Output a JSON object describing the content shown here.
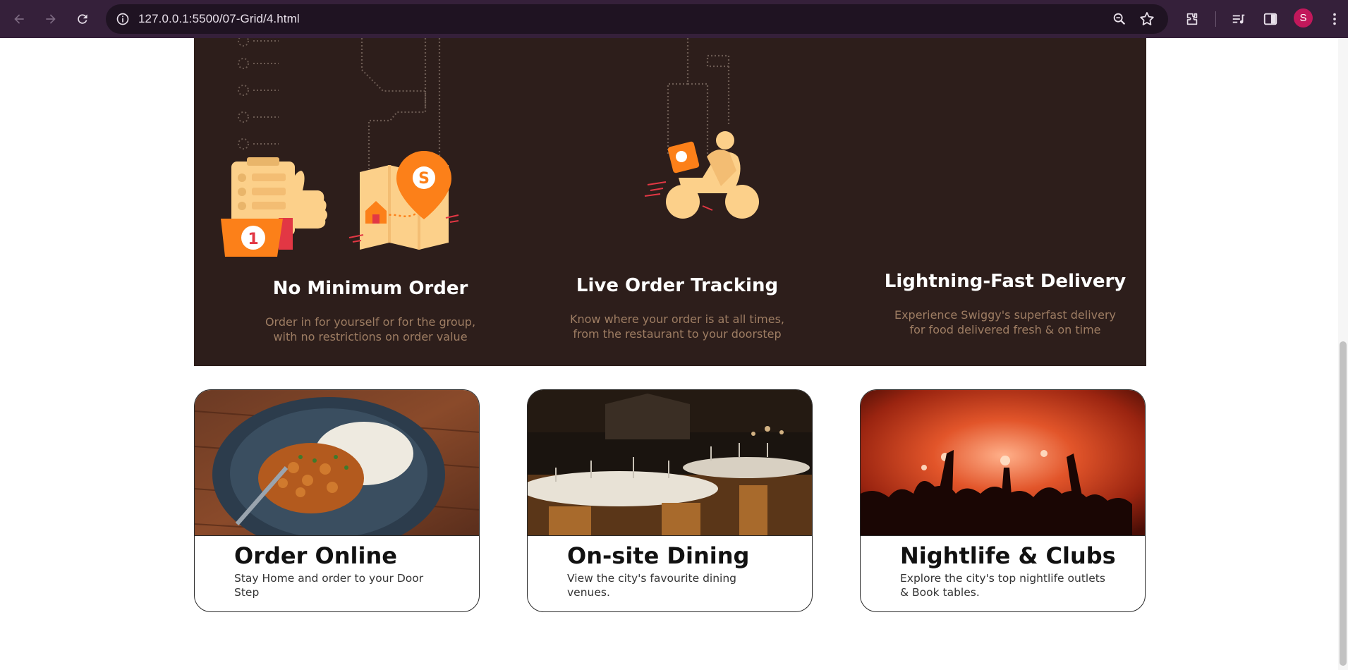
{
  "browser": {
    "url": "127.0.0.1:5500/07-Grid/4.html",
    "profile_initial": "S",
    "icons": [
      "back-icon",
      "forward-icon",
      "reload-icon",
      "site-info-icon",
      "zoom-icon",
      "bookmark-star-icon",
      "extensions-icon",
      "media-icon",
      "side-panel-icon",
      "menu-icon"
    ]
  },
  "features": [
    {
      "title": "No Minimum Order",
      "desc_line1": "Order in for yourself or for the group,",
      "desc_line2": "with no restrictions on order value"
    },
    {
      "title": "Live Order Tracking",
      "desc_line1": "Know where your order is at all times,",
      "desc_line2": "from the restaurant to your doorstep"
    },
    {
      "title": "Lightning-Fast Delivery",
      "desc_line1": "Experience Swiggy's superfast delivery",
      "desc_line2": "for food delivered fresh & on time"
    }
  ],
  "cards": [
    {
      "title": "Order Online",
      "desc": "Stay Home and order to your Door Step"
    },
    {
      "title": "On-site Dining",
      "desc": "View the city's favourite dining venues."
    },
    {
      "title": "Nightlife & Clubs",
      "desc": "Explore the city's top nightlife outlets & Book tables."
    }
  ],
  "colors": {
    "chrome_bg": "#35203a",
    "features_bg": "#2d1e1b",
    "feature_desc": "#9e7d63",
    "accent_orange": "#fc8019",
    "illustration_cream": "#fcd08a"
  }
}
